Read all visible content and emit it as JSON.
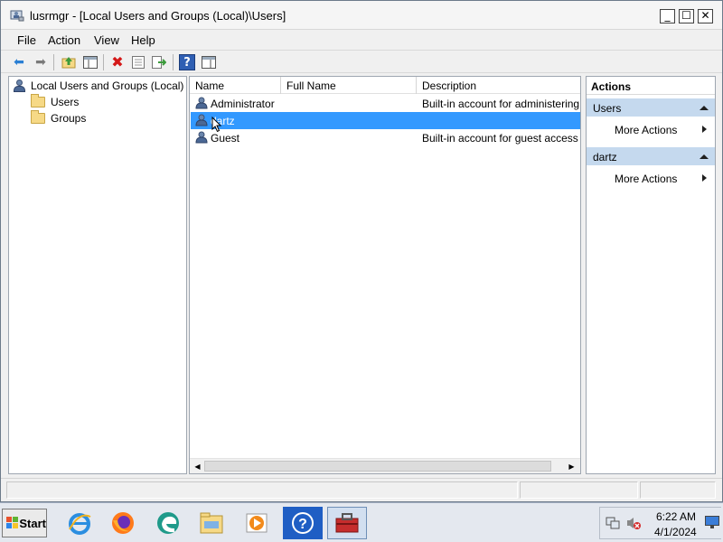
{
  "window": {
    "title": "lusrmgr - [Local Users and Groups (Local)\\Users]",
    "controls": {
      "minimize": "_",
      "maximize": "☐",
      "close": "✕"
    }
  },
  "menu": [
    "File",
    "Action",
    "View",
    "Help"
  ],
  "toolbar_icons": [
    "back-arrow-icon",
    "forward-arrow-icon",
    "up-folder-icon",
    "show-hide-tree-icon",
    "delete-icon",
    "properties-icon",
    "export-list-icon",
    "help-icon",
    "show-hide-action-pane-icon"
  ],
  "tree": {
    "root": "Local Users and Groups (Local)",
    "children": [
      "Users",
      "Groups"
    ]
  },
  "list": {
    "columns": [
      "Name",
      "Full Name",
      "Description"
    ],
    "rows": [
      {
        "name": "Administrator",
        "full_name": "",
        "description": "Built-in account for administering"
      },
      {
        "name": "dartz",
        "full_name": "",
        "description": ""
      },
      {
        "name": "Guest",
        "full_name": "",
        "description": "Built-in account for guest access t"
      }
    ],
    "selected_row": "dartz"
  },
  "actions": {
    "title": "Actions",
    "groups": [
      {
        "header": "Users",
        "item": "More Actions"
      },
      {
        "header": "dartz",
        "item": "More Actions"
      }
    ]
  },
  "taskbar": {
    "start_label": "Start",
    "apps": [
      "internet-explorer-icon",
      "firefox-icon",
      "edge-icon",
      "file-explorer-icon",
      "media-player-icon",
      "help-icon",
      "toolbox-icon"
    ],
    "clock_time": "6:22 AM",
    "clock_date": "4/1/2024"
  },
  "colors": {
    "selection": "#3399ff",
    "actions_header": "#c5d9ee",
    "window_bg": "#f0f0f0"
  }
}
